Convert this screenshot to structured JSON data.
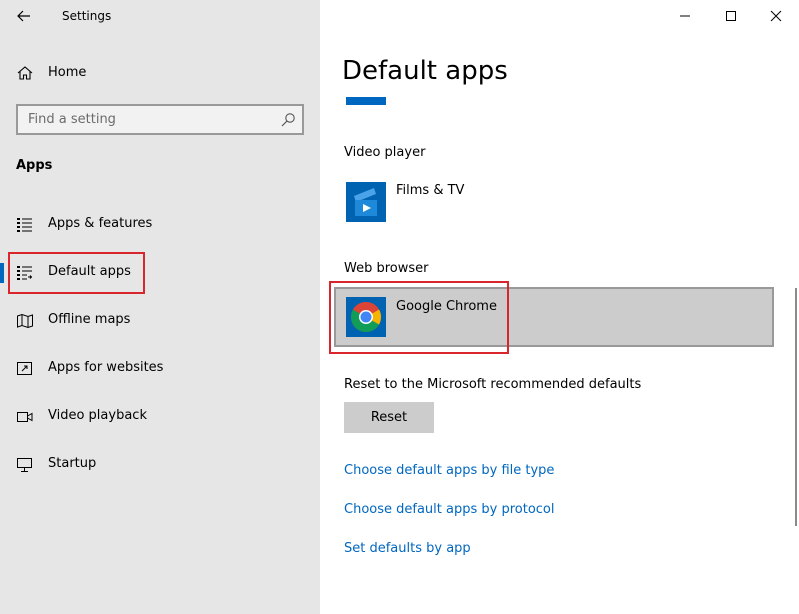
{
  "window": {
    "title": "Settings"
  },
  "sidebar": {
    "home_label": "Home",
    "search_placeholder": "Find a setting",
    "section_heading": "Apps",
    "items": [
      {
        "label": "Apps & features",
        "icon": "apps-features-icon"
      },
      {
        "label": "Default apps",
        "icon": "default-apps-icon",
        "selected": true
      },
      {
        "label": "Offline maps",
        "icon": "offline-maps-icon"
      },
      {
        "label": "Apps for websites",
        "icon": "apps-for-websites-icon"
      },
      {
        "label": "Video playback",
        "icon": "video-playback-icon"
      },
      {
        "label": "Startup",
        "icon": "startup-icon"
      }
    ]
  },
  "main": {
    "title": "Default apps",
    "video_player": {
      "label": "Video player",
      "app_name": "Films & TV",
      "icon": "films-tv-icon"
    },
    "web_browser": {
      "label": "Web browser",
      "app_name": "Google Chrome",
      "icon": "chrome-icon"
    },
    "reset": {
      "label": "Reset to the Microsoft recommended defaults",
      "button_label": "Reset"
    },
    "links": [
      "Choose default apps by file type",
      "Choose default apps by protocol",
      "Set defaults by app"
    ]
  },
  "colors": {
    "accent": "#0067c0",
    "highlight_red": "#d9262c",
    "sidebar_bg": "#e6e6e6",
    "selected_tile_bg": "#cccccc"
  }
}
